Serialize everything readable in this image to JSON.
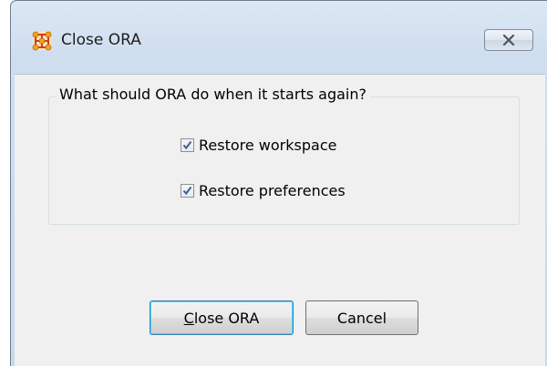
{
  "window": {
    "title": "Close ORA",
    "icon": "ora-network-icon",
    "close_icon": "close-x-icon"
  },
  "group": {
    "legend": "What should ORA do when it starts again?"
  },
  "options": [
    {
      "label": "Restore workspace",
      "checked": true
    },
    {
      "label": "Restore preferences",
      "checked": true
    }
  ],
  "buttons": {
    "close_label": "Close ORA",
    "cancel_label": "Cancel"
  },
  "colors": {
    "title_bar": "#cfdeef",
    "dialog_bg": "#f0f0f0",
    "check_mark": "#3d5f96",
    "icon_orange": "#f2a21c",
    "icon_red": "#d8332a"
  }
}
